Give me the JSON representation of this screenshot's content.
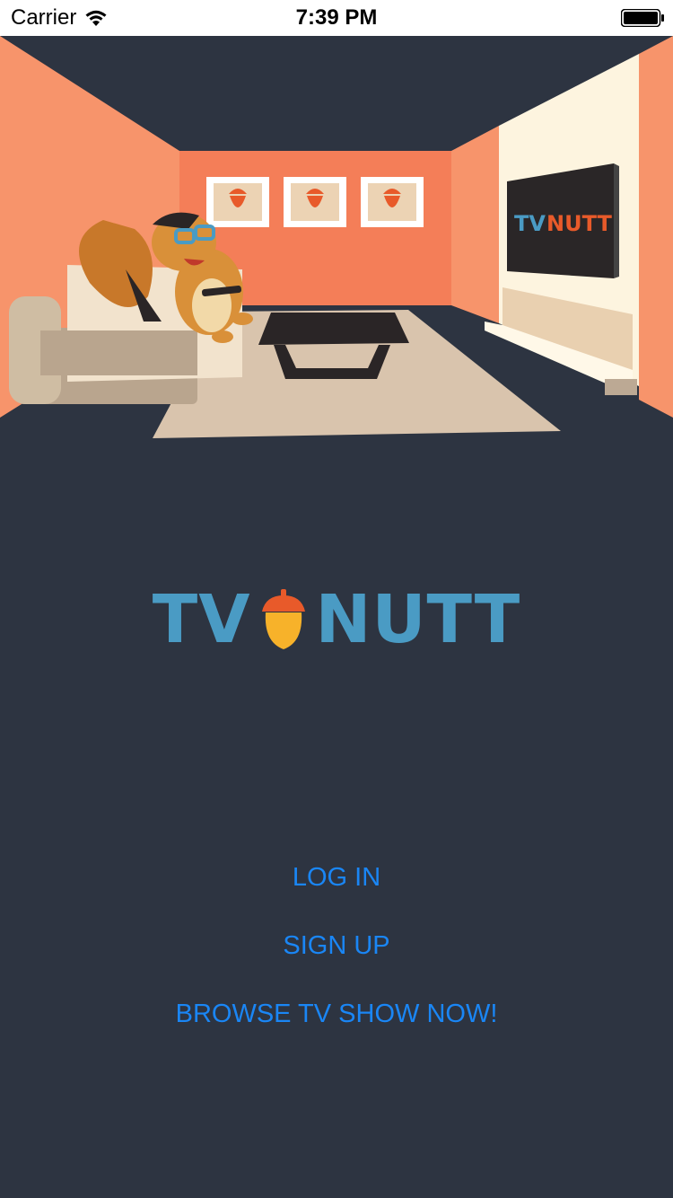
{
  "status_bar": {
    "carrier": "Carrier",
    "time": "7:39 PM",
    "icons": [
      "wifi-icon",
      "battery-icon"
    ]
  },
  "hero": {
    "tv_screen_text_a": "TV",
    "tv_screen_text_b": "NUTT",
    "colors": {
      "wall": "#f47e58",
      "side_wall": "#f7946b",
      "floor": "#2d3441",
      "rug": "#d9c4ad",
      "cabinet": "#fdf4df"
    }
  },
  "logo": {
    "left_word": "TV",
    "right_word": "NUTT",
    "icon": "acorn-icon",
    "color": "#4a9bc4"
  },
  "menu": {
    "login_label": "LOG IN",
    "signup_label": "SIGN UP",
    "browse_label": "BROWSE TV SHOW NOW!",
    "link_color": "#1a86f5"
  }
}
